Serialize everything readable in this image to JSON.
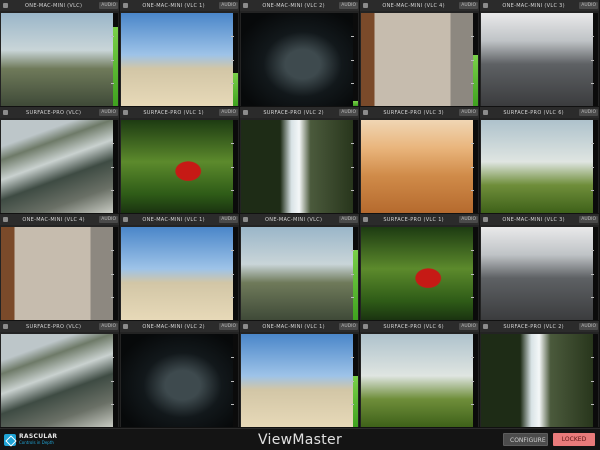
{
  "app": {
    "title": "ViewMaster"
  },
  "logo": {
    "brand": "RASCULAR",
    "tagline": "Controls in Depth"
  },
  "controls": {
    "configure_label": "CONFIGURE",
    "locked_label": "LOCKED"
  },
  "tiles": [
    {
      "label": "ONE-MAC-MINI (VLC)",
      "badge": "AUDIO",
      "scene": "street",
      "meter": 0.85
    },
    {
      "label": "ONE-MAC-MINI (VLC 1)",
      "badge": "AUDIO",
      "scene": "mountains",
      "meter": 0.35
    },
    {
      "label": "ONE-MAC-MINI (VLC 2)",
      "badge": "AUDIO",
      "scene": "bird",
      "meter": 0.05
    },
    {
      "label": "ONE-MAC-MINI (VLC 4)",
      "badge": "AUDIO",
      "scene": "car-wall",
      "meter": 0.55
    },
    {
      "label": "ONE-MAC-MINI (VLC 3)",
      "badge": "AUDIO",
      "scene": "highway",
      "meter": 0.0
    },
    {
      "label": "SURFACE-PRO (VLC)",
      "badge": "AUDIO",
      "scene": "race",
      "meter": 0.0
    },
    {
      "label": "SURFACE-PRO (VLC 1)",
      "badge": "AUDIO",
      "scene": "parrot",
      "meter": 0.0
    },
    {
      "label": "SURFACE-PRO (VLC 2)",
      "badge": "AUDIO",
      "scene": "waterfall",
      "meter": 0.0
    },
    {
      "label": "SURFACE-PRO (VLC 3)",
      "badge": "AUDIO",
      "scene": "beach",
      "meter": 0.0
    },
    {
      "label": "SURFACE-PRO (VLC 6)",
      "badge": "AUDIO",
      "scene": "grass",
      "meter": 0.0
    },
    {
      "label": "ONE-MAC-MINI (VLC 4)",
      "badge": "AUDIO",
      "scene": "car-wall",
      "meter": 0.0
    },
    {
      "label": "ONE-MAC-MINI (VLC 1)",
      "badge": "AUDIO",
      "scene": "mountains",
      "meter": 0.0
    },
    {
      "label": "ONE-MAC-MINI (VLC)",
      "badge": "AUDIO",
      "scene": "street",
      "meter": 0.75
    },
    {
      "label": "SURFACE-PRO (VLC 1)",
      "badge": "AUDIO",
      "scene": "parrot",
      "meter": 0.0
    },
    {
      "label": "ONE-MAC-MINI (VLC 3)",
      "badge": "AUDIO",
      "scene": "highway",
      "meter": 0.0
    },
    {
      "label": "SURFACE-PRO (VLC)",
      "badge": "AUDIO",
      "scene": "race",
      "meter": 0.0
    },
    {
      "label": "ONE-MAC-MINI (VLC 2)",
      "badge": "AUDIO",
      "scene": "bird",
      "meter": 0.0
    },
    {
      "label": "ONE-MAC-MINI (VLC 1)",
      "badge": "AUDIO",
      "scene": "mountains",
      "meter": 0.55
    },
    {
      "label": "SURFACE-PRO (VLC 6)",
      "badge": "AUDIO",
      "scene": "grass",
      "meter": 0.0
    },
    {
      "label": "SURFACE-PRO (VLC 2)",
      "badge": "AUDIO",
      "scene": "waterfall",
      "meter": 0.0
    }
  ],
  "colors": {
    "meter": "#5bbf33",
    "locked": "#e97b7b",
    "accent": "#1fa4d6"
  }
}
